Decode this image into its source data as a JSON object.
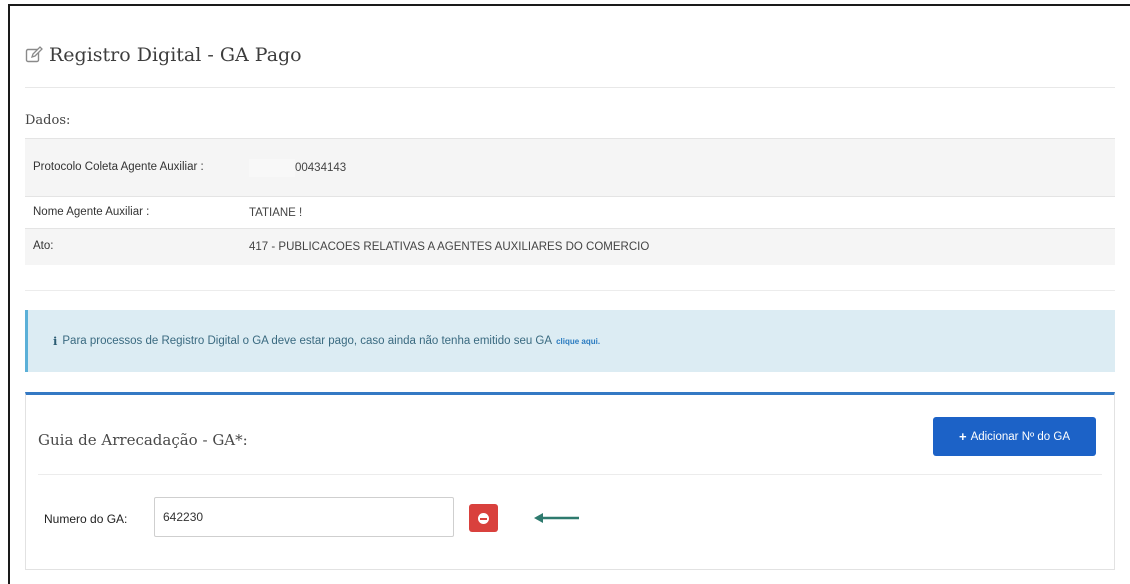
{
  "header": {
    "title": "Registro Digital - GA Pago",
    "title_icon": "edit-icon"
  },
  "dados": {
    "label": "Dados:",
    "rows": [
      {
        "key": "Protocolo Coleta Agente Auxiliar :",
        "value": "00434143"
      },
      {
        "key": "Nome Agente Auxiliar :",
        "value": "TATIANE !"
      },
      {
        "key": "Ato:",
        "value": "417 - PUBLICACOES RELATIVAS A AGENTES AUXILIARES DO COMERCIO"
      }
    ]
  },
  "info": {
    "icon": "info-icon",
    "text": "Para processos de Registro Digital o GA deve estar pago, caso ainda não tenha emitido seu GA",
    "link_text": "clique aqui."
  },
  "ga_panel": {
    "title": "Guia de Arrecadação - GA*:",
    "add_button_label": "Adicionar Nº do GA",
    "field_label": "Numero do GA:",
    "field_value": "642230"
  },
  "colors": {
    "primary": "#1c62c7",
    "danger": "#d9413d",
    "info_bg": "#dcecf3",
    "arrow": "#2e7a6e"
  }
}
